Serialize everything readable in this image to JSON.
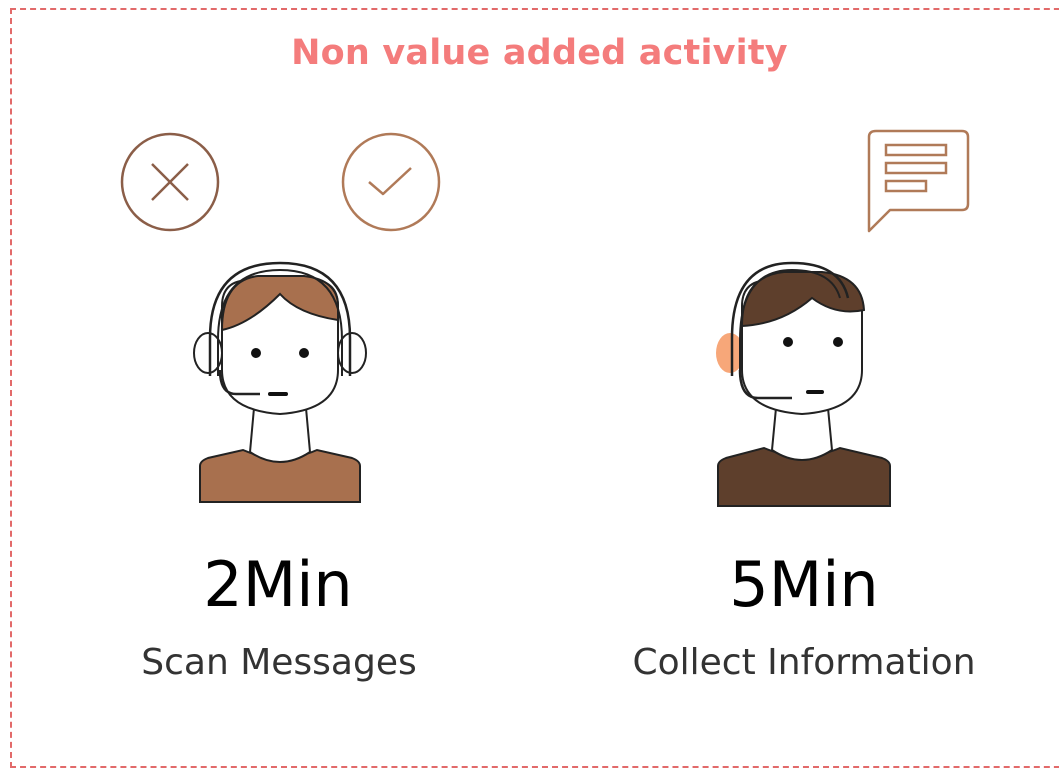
{
  "title": "Non value added activity",
  "colors": {
    "frame": "#e26a6a",
    "title": "#f47c7c",
    "icon_brown": "#8b5e48",
    "icon_tan": "#b07a58",
    "hair_left": "#a8704e",
    "shirt_left": "#a8704e",
    "hair_right": "#5e3f2c",
    "shirt_right": "#5e3f2c",
    "ear_right": "#f7a779"
  },
  "steps": [
    {
      "time": "2Min",
      "label": "Scan Messages",
      "icons": [
        "reject-icon",
        "approve-icon",
        "agent-headset-icon"
      ]
    },
    {
      "time": "5Min",
      "label": "Collect Information",
      "icons": [
        "chat-message-icon",
        "agent-headset-icon"
      ]
    }
  ]
}
